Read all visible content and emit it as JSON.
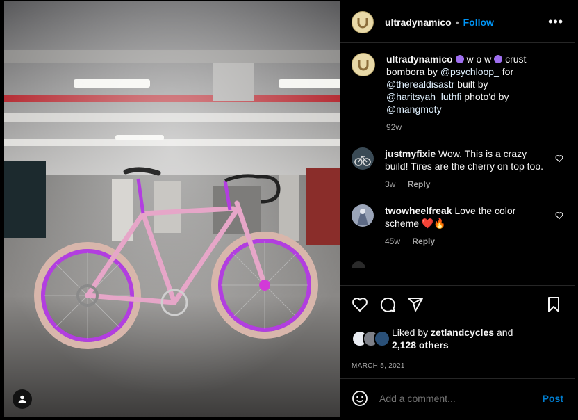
{
  "post": {
    "username": "ultradynamico",
    "separator": "•",
    "follow_label": "Follow",
    "more_icon": "more-horizontal-icon",
    "caption": {
      "word": "w o w",
      "text1": "crust bombora by",
      "m1": "@psychloop_",
      "text2": "for",
      "m2": "@therealdisastr",
      "text3": "built by",
      "m3": "@haritsyah_luthfi",
      "text4": "photo'd by",
      "m4": "@mangmoty",
      "time": "92w"
    },
    "comments": [
      {
        "user": "justmyfixie",
        "text": "Wow. This is a crazy build! Tires are the cherry on top too.",
        "time": "3w",
        "reply": "Reply"
      },
      {
        "user": "twowheelfreak",
        "text": "Love the color scheme",
        "emoji": "❤️🔥",
        "time": "45w",
        "reply": "Reply"
      }
    ],
    "likes": {
      "prefix": "Liked by",
      "user": "zetlandcycles",
      "middle": "and",
      "count": "2,128 others"
    },
    "date": "MARCH 5, 2021",
    "add_comment_placeholder": "Add a comment...",
    "post_label": "Post"
  },
  "colors": {
    "accent": "#0095f6",
    "bike": "#e6a6c8",
    "rim": "#b23ee0"
  }
}
